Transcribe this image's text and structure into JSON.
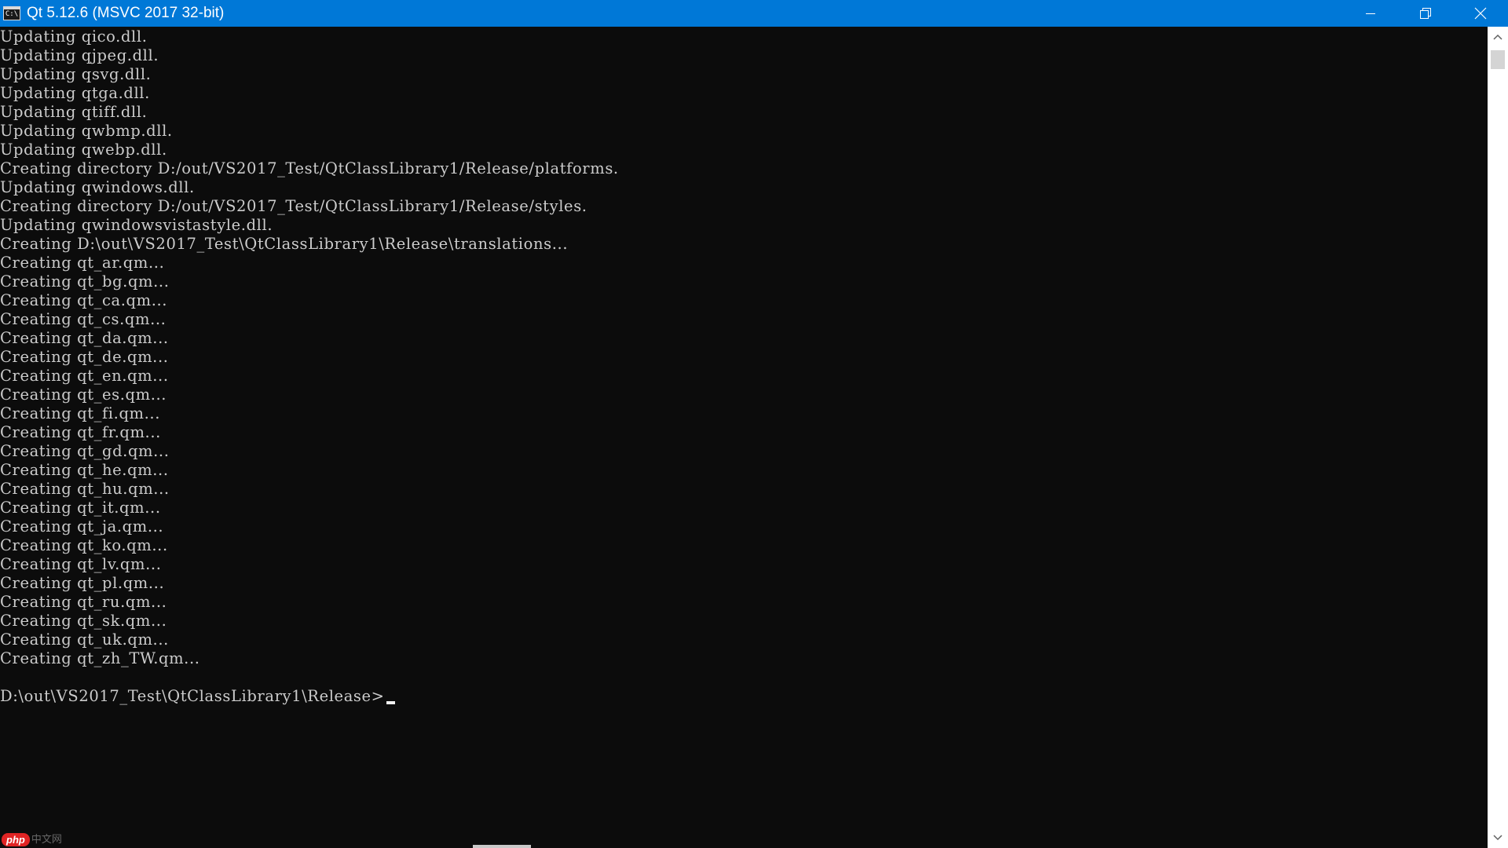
{
  "window": {
    "title": "Qt 5.12.6 (MSVC 2017 32-bit)",
    "icon_glyph": "C:\\",
    "icons": {
      "app": "console-icon",
      "minimize": "minimize-icon",
      "restore": "restore-icon",
      "close": "close-icon"
    },
    "colors": {
      "titlebar": "#0078d7",
      "console_bg": "#0c0c0c",
      "console_text": "#cccccc",
      "scrollbar_bg": "#ffffff",
      "scrollbar_thumb": "#d4d4d4"
    }
  },
  "console": {
    "lines": [
      "Updating qico.dll.",
      "Updating qjpeg.dll.",
      "Updating qsvg.dll.",
      "Updating qtga.dll.",
      "Updating qtiff.dll.",
      "Updating qwbmp.dll.",
      "Updating qwebp.dll.",
      "Creating directory D:/out/VS2017_Test/QtClassLibrary1/Release/platforms.",
      "Updating qwindows.dll.",
      "Creating directory D:/out/VS2017_Test/QtClassLibrary1/Release/styles.",
      "Updating qwindowsvistastyle.dll.",
      "Creating D:\\out\\VS2017_Test\\QtClassLibrary1\\Release\\translations...",
      "Creating qt_ar.qm...",
      "Creating qt_bg.qm...",
      "Creating qt_ca.qm...",
      "Creating qt_cs.qm...",
      "Creating qt_da.qm...",
      "Creating qt_de.qm...",
      "Creating qt_en.qm...",
      "Creating qt_es.qm...",
      "Creating qt_fi.qm...",
      "Creating qt_fr.qm...",
      "Creating qt_gd.qm...",
      "Creating qt_he.qm...",
      "Creating qt_hu.qm...",
      "Creating qt_it.qm...",
      "Creating qt_ja.qm...",
      "Creating qt_ko.qm...",
      "Creating qt_lv.qm...",
      "Creating qt_pl.qm...",
      "Creating qt_ru.qm...",
      "Creating qt_sk.qm...",
      "Creating qt_uk.qm...",
      "Creating qt_zh_TW.qm...",
      ""
    ],
    "prompt": "D:\\out\\VS2017_Test\\QtClassLibrary1\\Release>"
  },
  "scrollbar": {
    "icons": {
      "up": "scroll-up-arrow-icon",
      "down": "scroll-down-arrow-icon"
    }
  },
  "watermark": {
    "badge": "php",
    "text": "中文网"
  }
}
